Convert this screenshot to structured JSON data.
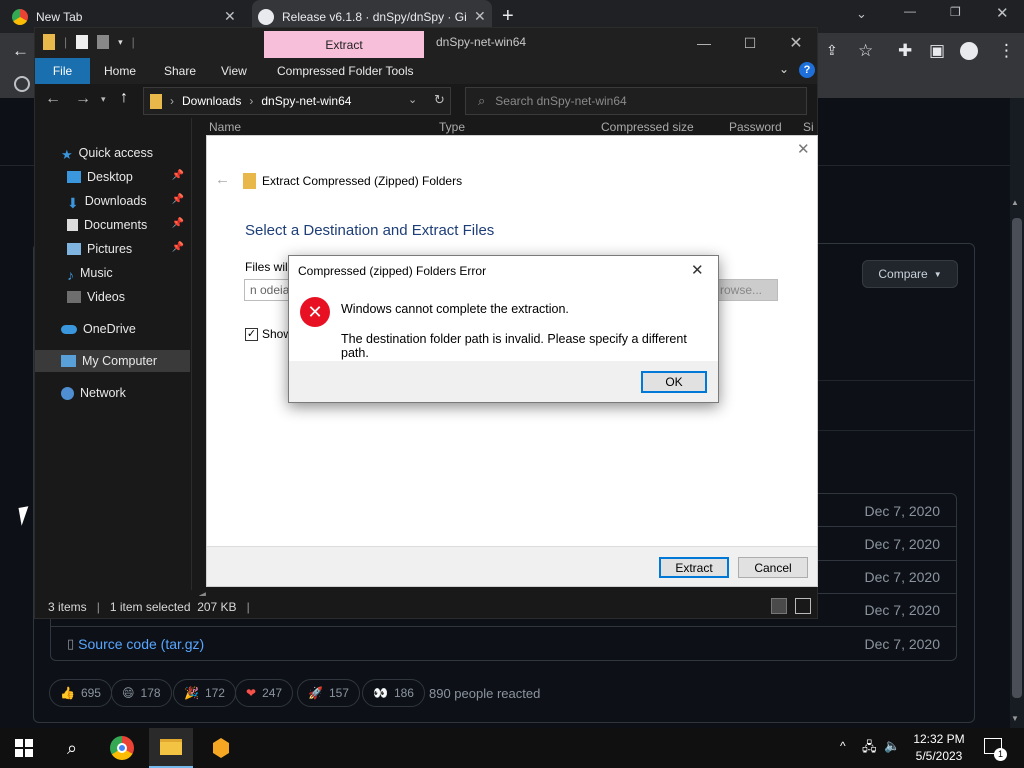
{
  "chrome": {
    "tabs": [
      {
        "title": "New Tab"
      },
      {
        "title": "Release v6.1.8 · dnSpy/dnSpy · Gi"
      }
    ],
    "new_tab_symbol": "+"
  },
  "github": {
    "compare_label": "Compare",
    "assets": [
      {
        "date": "Dec 7, 2020"
      },
      {
        "date": "Dec 7, 2020"
      },
      {
        "date": "Dec 7, 2020"
      },
      {
        "date": "Dec 7, 2020"
      },
      {
        "name": "Source code (tar.gz)",
        "date": "Dec 7, 2020"
      }
    ],
    "reactions": [
      {
        "emoji": "👍",
        "count": "695"
      },
      {
        "emoji": "😄",
        "count": "178"
      },
      {
        "emoji": "🎉",
        "count": "172"
      },
      {
        "emoji": "❤",
        "count": "247"
      },
      {
        "emoji": "🚀",
        "count": "157"
      },
      {
        "emoji": "👀",
        "count": "186"
      }
    ],
    "reaction_summary": "890 people reacted"
  },
  "explorer": {
    "context_tab": "Extract",
    "title": "dnSpy-net-win64",
    "ribbon_tabs": [
      "File",
      "Home",
      "Share",
      "View",
      "Compressed Folder Tools"
    ],
    "breadcrumb": [
      "Downloads",
      "dnSpy-net-win64"
    ],
    "search_placeholder": "Search dnSpy-net-win64",
    "columns": [
      "Name",
      "Type",
      "Compressed size",
      "Password",
      "Si"
    ],
    "nav": [
      {
        "label": "Quick access"
      },
      {
        "label": "Desktop"
      },
      {
        "label": "Downloads"
      },
      {
        "label": "Documents"
      },
      {
        "label": "Pictures"
      },
      {
        "label": "Music"
      },
      {
        "label": "Videos"
      },
      {
        "label": "OneDrive"
      },
      {
        "label": "My Computer"
      },
      {
        "label": "Network"
      }
    ],
    "status": {
      "items": "3 items",
      "selected": "1 item selected  207 KB"
    }
  },
  "wizard": {
    "title": "Extract Compressed (Zipped) Folders",
    "heading": "Select a Destination and Extract Files",
    "files_label": "Files will",
    "path_value": "n odeia",
    "browse_label": "rowse...",
    "show_label": "Show",
    "extract_label": "Extract",
    "cancel_label": "Cancel"
  },
  "error": {
    "title": "Compressed (zipped) Folders Error",
    "message": "Windows cannot complete the extraction.",
    "detail": "The destination folder path is invalid. Please specify a different path.",
    "ok_label": "OK"
  },
  "taskbar": {
    "time": "12:32 PM",
    "date": "5/5/2023",
    "notification_count": "1"
  }
}
